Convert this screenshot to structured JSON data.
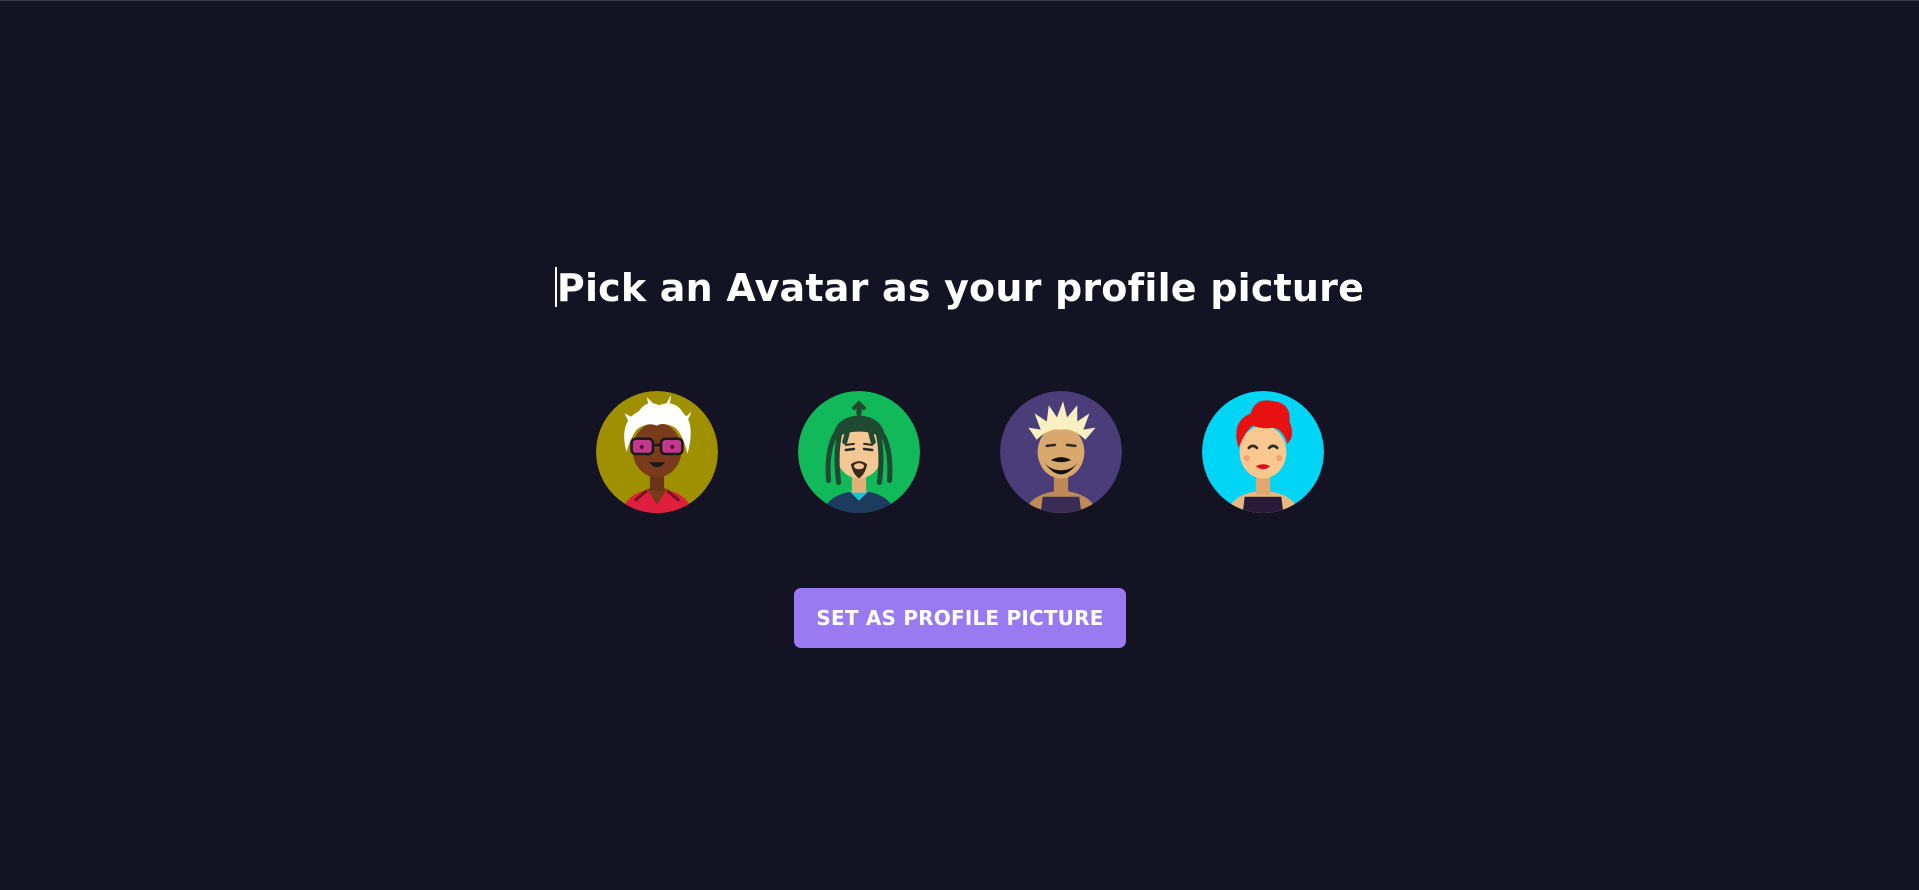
{
  "page": {
    "title": "Pick an Avatar as your profile picture",
    "background_color": "#131324"
  },
  "avatars": [
    {
      "icon": "avatar-white-hair-glasses",
      "bg_color": "#9e9000",
      "selected": false
    },
    {
      "icon": "avatar-dreadlocks",
      "bg_color": "#11b95a",
      "selected": false
    },
    {
      "icon": "avatar-blond-beard",
      "bg_color": "#4a3d7a",
      "selected": false
    },
    {
      "icon": "avatar-red-hair-woman",
      "bg_color": "#00d5f5",
      "selected": false
    }
  ],
  "actions": {
    "submit_label": "SET AS PROFILE PICTURE",
    "button_color": "#997af0"
  }
}
